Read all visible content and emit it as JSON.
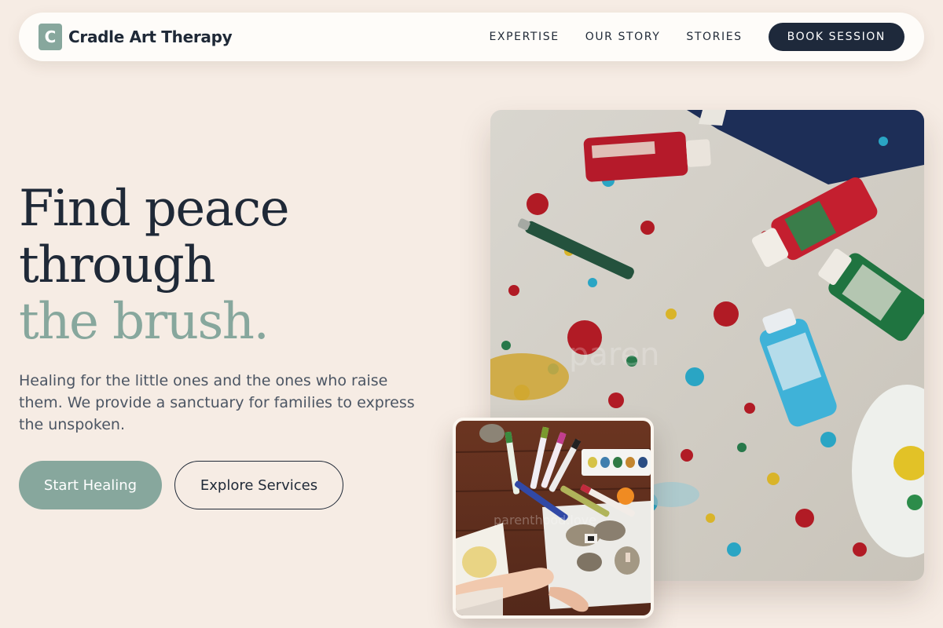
{
  "brand": {
    "initial": "C",
    "name": "Cradle Art Therapy"
  },
  "nav": {
    "links": [
      "EXPERTISE",
      "OUR STORY",
      "STORIES"
    ],
    "cta": "BOOK SESSION"
  },
  "hero": {
    "headline_line1": "Find peace",
    "headline_line2": "through",
    "headline_accent": "the brush.",
    "subtext": "Healing for the little ones and the ones who raise them. We provide a sanctuary for families to express the unspoken.",
    "primary_button": "Start Healing",
    "secondary_button": "Explore Services"
  },
  "colors": {
    "background": "#f6ece4",
    "accent_sage": "#87a79d",
    "dark_navy": "#1e293b",
    "nav_bg": "#fefcf9"
  },
  "images": {
    "main": "paint-splattered-table-photo",
    "secondary": "kids-markers-painting-rocks-photo"
  }
}
